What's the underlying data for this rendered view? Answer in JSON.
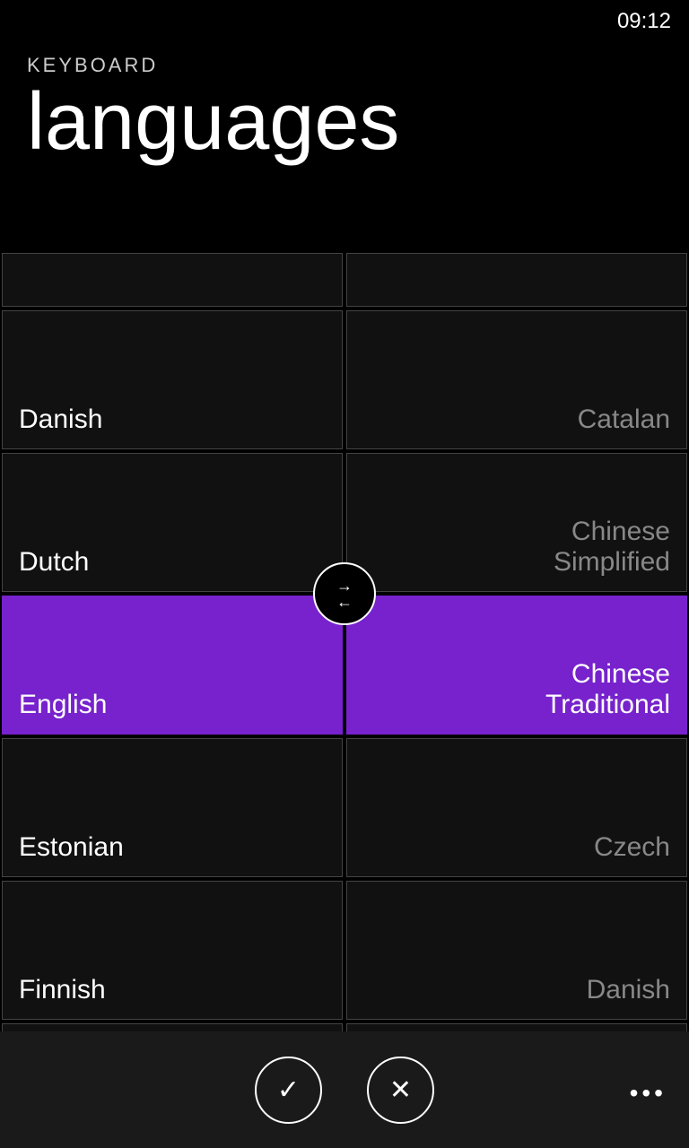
{
  "status": {
    "time": "09:12"
  },
  "header": {
    "section_label": "KEYBOARD",
    "title": "languages"
  },
  "left_column": [
    {
      "id": "partial-top-left",
      "label": "",
      "partial": true,
      "selected": false,
      "dimmed": false
    },
    {
      "id": "danish-left",
      "label": "Danish",
      "selected": false,
      "dimmed": false
    },
    {
      "id": "dutch-left",
      "label": "Dutch",
      "selected": false,
      "dimmed": false
    },
    {
      "id": "english-left",
      "label": "English",
      "selected": true,
      "dimmed": false
    },
    {
      "id": "estonian-left",
      "label": "Estonian",
      "selected": false,
      "dimmed": false
    },
    {
      "id": "finnish-left",
      "label": "Finnish",
      "selected": false,
      "dimmed": false
    },
    {
      "id": "partial-bottom-left",
      "label": "",
      "partial": true,
      "selected": false,
      "dimmed": false
    }
  ],
  "right_column": [
    {
      "id": "partial-top-right",
      "label": "",
      "partial": true,
      "selected": false,
      "dimmed": false
    },
    {
      "id": "catalan-right",
      "label": "Catalan",
      "selected": false,
      "dimmed": true,
      "align": "right"
    },
    {
      "id": "chinese-simplified-right",
      "label": "Chinese Simplified",
      "selected": false,
      "dimmed": true,
      "align": "right"
    },
    {
      "id": "chinese-traditional-right",
      "label": "Chinese Traditional",
      "selected": true,
      "dimmed": false,
      "align": "right"
    },
    {
      "id": "czech-right",
      "label": "Czech",
      "selected": false,
      "dimmed": true,
      "align": "right"
    },
    {
      "id": "danish-right",
      "label": "Danish",
      "selected": false,
      "dimmed": true,
      "align": "right"
    },
    {
      "id": "partial-bottom-right",
      "label": "",
      "partial": true,
      "selected": false,
      "dimmed": false
    }
  ],
  "swap_button": {
    "label": "⇄"
  },
  "bottom_bar": {
    "confirm_label": "✓",
    "cancel_label": "✕",
    "more_label": "•••"
  }
}
